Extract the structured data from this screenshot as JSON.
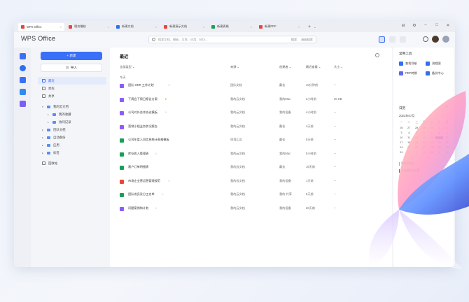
{
  "tabs": [
    {
      "label": "WPS Office",
      "color": "#e8453c",
      "active": true
    },
    {
      "label": "税务稽核",
      "color": "#e8453c"
    },
    {
      "label": "新建文档",
      "color": "#2f6ff2"
    },
    {
      "label": "新建演示文档",
      "color": "#e8453c"
    },
    {
      "label": "新建表格",
      "color": "#1a9e5a"
    },
    {
      "label": "新建PDF",
      "color": "#e8453c"
    }
  ],
  "tabstrip": {
    "plus": "+",
    "chevron": "⌄"
  },
  "window_controls": [
    "⊟",
    "⚙",
    "–",
    "□",
    "✕"
  ],
  "header": {
    "logo": "WPS Office",
    "search_placeholder": "搜索文档、模板、文库、应用、技巧...",
    "search_right_1": "搜索",
    "search_right_2": "高级搜索"
  },
  "sidenav": {
    "new_label": "+ 新建",
    "import_label": "导入",
    "items": [
      {
        "label": "最近",
        "active": true,
        "type": "item"
      },
      {
        "label": "星标",
        "type": "item"
      },
      {
        "label": "共享",
        "type": "item"
      },
      {
        "label": "我的云文档",
        "type": "folder",
        "caret": "▾"
      },
      {
        "label": "我的收藏",
        "type": "folder-sub",
        "caret": "▸"
      },
      {
        "label": "协同记录",
        "type": "folder-sub",
        "caret": "▸"
      },
      {
        "label": "团队文档",
        "type": "folder",
        "caret": "▸"
      },
      {
        "label": "自动备份",
        "type": "folder",
        "caret": "▸"
      },
      {
        "label": "应用",
        "type": "folder",
        "caret": "▸"
      },
      {
        "label": "标签",
        "type": "folder",
        "caret": "▸"
      },
      {
        "label": "回收站",
        "type": "item"
      }
    ]
  },
  "main": {
    "title": "最近",
    "columns": {
      "name": "全部类型 ⌄",
      "source": "来源 ⌄",
      "creator": "创建者 ⌄",
      "time": "最近查看 ⌄",
      "size": "大小 ⌄"
    },
    "section_today": "今天",
    "rows": [
      {
        "name": "团队 OKR 工作计划",
        "icon_color": "#8b5cf6",
        "source": "团队文档",
        "creator": "戴佳",
        "time": "10分钟前",
        "size": "--",
        "tag": "☆"
      },
      {
        "name": "下周会下周日报告方案",
        "icon_color": "#8b5cf6",
        "source": "我的云文档",
        "creator": "我的Mac",
        "time": "2小时前",
        "size": "30 KB",
        "tag": "★"
      },
      {
        "name": "公司对外合作协议模板",
        "icon_color": "#8b5cf6",
        "source": "我的云文档",
        "creator": "我的设备",
        "time": "4小时前",
        "size": "--",
        "tag": "☆"
      },
      {
        "name": "营销小组业务状况报告",
        "icon_color": "#8b5cf6",
        "source": "我的云文档",
        "creator": "戴佳",
        "time": "4天前",
        "size": "--",
        "tag": ""
      },
      {
        "name": "公司年度人员信息统计表格模板",
        "icon_color": "#1a9e5a",
        "source": "项目汇总",
        "creator": "戴佳",
        "time": "5天前",
        "size": "--",
        "tag": ""
      },
      {
        "name": "库存收入管理表",
        "icon_color": "#1a9e5a",
        "source": "我的云文档",
        "creator": "我的Mac",
        "time": "5小时前",
        "size": "--",
        "tag": "☆"
      },
      {
        "name": "客户订单明细表",
        "icon_color": "#1a9e5a",
        "source": "我的云文档",
        "creator": "戴佳",
        "time": "16天前",
        "size": "--",
        "tag": ""
      },
      {
        "name": "市场企业营运营管理规范",
        "icon_color": "#e8453c",
        "source": "我的云文档",
        "creator": "我的设备",
        "time": "1天前",
        "size": "--",
        "tag": "☆"
      },
      {
        "name": "团队成员及分工名单",
        "icon_color": "#1a9e5a",
        "source": "我的云文档",
        "creator": "我的 共享",
        "time": "5天前",
        "size": "--",
        "tag": "☆"
      },
      {
        "name": "问题案例和计划",
        "icon_color": "#8b5cf6",
        "source": "我的云文档",
        "creator": "我的设备",
        "time": "20天前",
        "size": "--",
        "tag": "☆"
      }
    ]
  },
  "right": {
    "tools_title": "常用工具",
    "tools": [
      {
        "label": "查找导航",
        "color": "#2f6ff2"
      },
      {
        "label": "流程图",
        "color": "#2f6ff2"
      },
      {
        "label": "PDF转换",
        "color": "#6366f1"
      },
      {
        "label": "备份中心",
        "color": "#2f6ff2"
      }
    ],
    "calendar_title": "日历",
    "calendar_plus": "+",
    "calendar_month": "2023年07月",
    "calendar_nav_prev": "‹",
    "calendar_nav_next": "›",
    "weekdays": [
      "一",
      "二",
      "三",
      "四",
      "五",
      "六",
      "日"
    ],
    "days": [
      "26",
      "27",
      "28",
      "29",
      "30",
      "1",
      "2",
      "3",
      "4",
      "5",
      "6",
      "7",
      "8",
      "9",
      "10",
      "11",
      "12",
      "13",
      "14",
      "15",
      "16",
      "17",
      "18",
      "19",
      "20",
      "21",
      "22",
      "23",
      "24",
      "25",
      "26",
      "27",
      "28",
      "29",
      "30",
      "31",
      "1",
      "2",
      "3",
      "4",
      "5",
      "6"
    ],
    "today_index": 19,
    "events": [
      {
        "label": "早餐回顾会",
        "color": "#f0a030"
      },
      {
        "label": "进度更新与汇报",
        "color": "#3a6ff7"
      }
    ]
  }
}
